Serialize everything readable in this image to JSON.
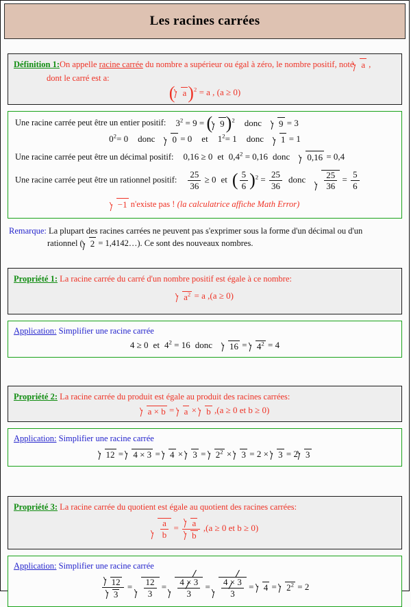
{
  "header": {
    "title": "Les racines carrées"
  },
  "definition": {
    "label": "Définition 1:",
    "text_1": "On appelle ",
    "text_underlined": "racine carrée",
    "text_2": " du nombre a supérieur ou égal à zéro, le nombre positif, noté",
    "text_3": "dont le carré est a:",
    "radicand": "a",
    "formula_tail": "= a , (a ≥ 0)",
    "exponent": "2"
  },
  "examples": {
    "line1_text": "Une racine carrée peut être un entier positif:",
    "line1_math": "3² = 9 = (√9)²  donc  √9 = 3",
    "line2_math": "0² = 0  donc  √0 = 0  et  1² = 1  donc  √1 = 1",
    "line3_text": "Une racine carrée peut être un décimal positif:",
    "line3_math": "0,16 ≥ 0  et  0,4² = 0,16  donc  √0,16 = 0,4",
    "line4_text": "Une racine carrée peut être un rationnel positif:",
    "line4_math": "25/36 ≥ 0  et  (5/6)² = 25/36  donc  √(25/36) = 5/6",
    "warning_math": "√−1",
    "warning_text": " n'existe pas ! ",
    "warning_italic": "(la calculatrice affiche Math Error)",
    "nums": {
      "three": "3",
      "nine": "9",
      "zero": "0",
      "one": "1",
      "dec_a": "0,16",
      "dec_b": "0,4",
      "num25": "25",
      "den36": "36",
      "num5": "5",
      "den6": "6",
      "minus_one": "−1",
      "exp2": "2"
    }
  },
  "remark": {
    "label": "Remarque:",
    "text_1": "La plupart des racines carrées ne peuvent pas s'exprimer sous la forme d'un décimal ou d'un",
    "text_2a": "rationnel (",
    "radicand": "2",
    "text_2b": "= 1,4142…). Ce sont des nouveaux nombres."
  },
  "property1": {
    "label": "Propriété 1:",
    "text": "La racine carrée du carré d'un nombre positif est égale à ce nombre:",
    "formula_radicand": "a",
    "formula_exp": "2",
    "formula_tail": "= a ,(a ≥ 0)"
  },
  "application1": {
    "label": "Application:",
    "text": "Simplifier une racine carrée",
    "math": "4 ≥ 0  et  4² = 16  donc  √16 = √4² = 4",
    "parts": {
      "four": "4",
      "sixteen": "16",
      "exp2": "2",
      "result": "4"
    }
  },
  "property2": {
    "label": "Propriété 2:",
    "text": "La racine carrée du produit est égale au produit des racines carrées:",
    "formula": "√(a × b) = √a × √b ,(a ≥ 0 et b ≥ 0)",
    "parts": {
      "ab": "a × b",
      "a": "a",
      "b": "b",
      "cond": ",(a ≥ 0  et  b ≥ 0)"
    }
  },
  "application2": {
    "label": "Application:",
    "text": "Simplifier une racine carrée",
    "math": "√12 = √(4×3) = √4 × √3 = √2² × √3 = 2 × √3 = 2√3",
    "parts": {
      "twelve": "12",
      "fourtimes3": "4 × 3",
      "four": "4",
      "three": "3",
      "two": "2",
      "exp2": "2"
    }
  },
  "property3": {
    "label": "Propriété 3:",
    "text": "La racine carrée du quotient est égale au quotient des racines carrées:",
    "formula": "√(a/b) = √a / √b ,(a ≥ 0 et b ≥ 0)",
    "parts": {
      "a": "a",
      "b": "b",
      "cond": ",(a ≥ 0  et  b ≥ 0)"
    }
  },
  "application3": {
    "label": "Application:",
    "text": "Simplifier une racine carrée",
    "math": "√12/√3 = √(12/3) = √(4×3̸/3̸) = √(4×3̸/3̸) = √4 = √2² = 2",
    "parts": {
      "twelve": "12",
      "three": "3",
      "four": "4",
      "two": "2",
      "exp2": "2",
      "result": "2"
    }
  },
  "colors": {
    "header_bg": "#dec2b2",
    "box_gray": "#eeeeee",
    "green_border": "#17a117",
    "label_green": "#108c10",
    "red": "#ef3124",
    "blue": "#2222cc"
  }
}
